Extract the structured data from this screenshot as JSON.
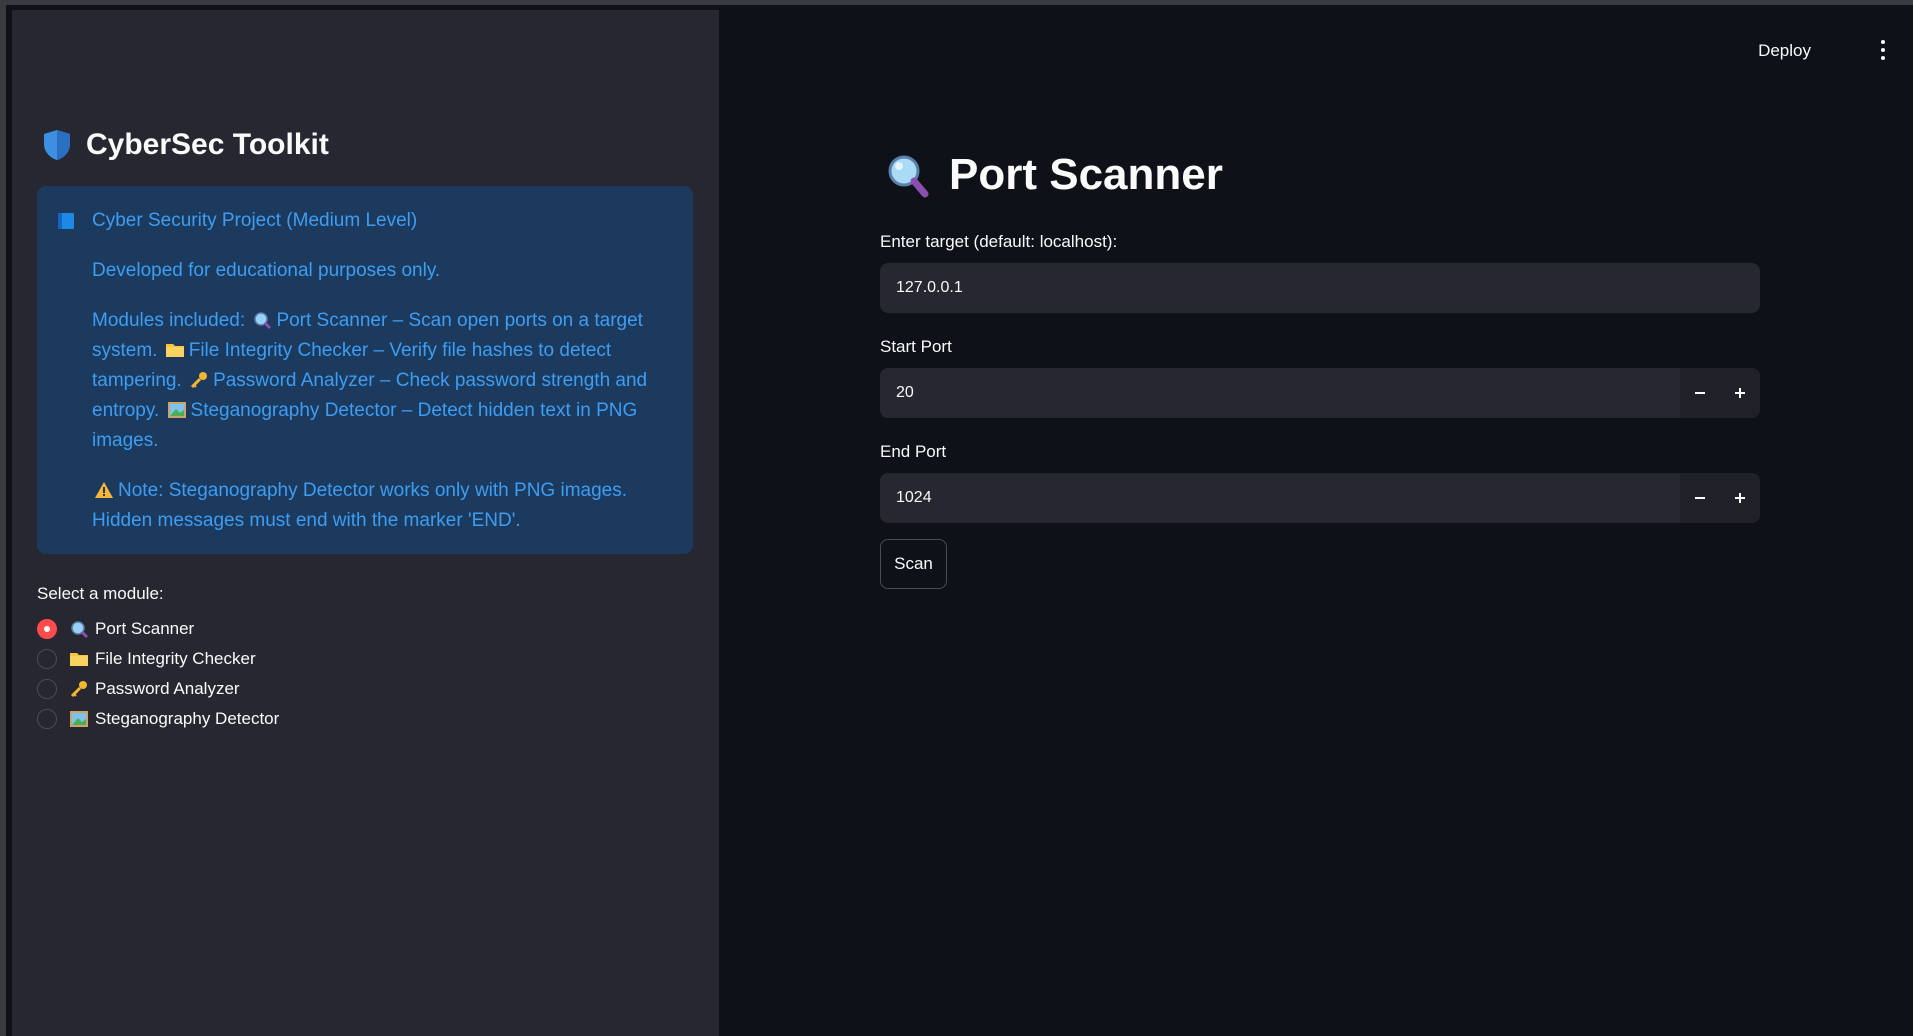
{
  "sidebar": {
    "title": "CyberSec Toolkit",
    "title_icon": "shield-icon",
    "info": {
      "book_icon": "blue-book-icon",
      "heading": "Cyber Security Project (Medium Level)",
      "purpose": "Developed for educational purposes only.",
      "modules_prefix": "Modules included:",
      "module_port": "Port Scanner – Scan open ports on a target system.",
      "module_file": "File Integrity Checker – Verify file hashes to detect tampering.",
      "module_password": "Password Analyzer – Check password strength and entropy.",
      "module_stego": "Steganography Detector – Detect hidden text in PNG images.",
      "note_line1": "Note: Steganography Detector works only with PNG images.",
      "note_line2": "Hidden messages must end with the marker 'END'."
    },
    "radio_label": "Select a module:",
    "radio_options": [
      {
        "label": "Port Scanner",
        "icon": "magnifier-icon",
        "checked": true
      },
      {
        "label": "File Integrity Checker",
        "icon": "folder-icon",
        "checked": false
      },
      {
        "label": "Password Analyzer",
        "icon": "key-icon",
        "checked": false
      },
      {
        "label": "Steganography Detector",
        "icon": "picture-icon",
        "checked": false
      }
    ]
  },
  "header": {
    "deploy_label": "Deploy",
    "menu_icon": "vertical-dots-icon"
  },
  "main": {
    "title": "Port Scanner",
    "title_icon": "magnifier-icon",
    "target_label": "Enter target (default: localhost):",
    "target_value": "127.0.0.1",
    "start_port_label": "Start Port",
    "start_port_value": "20",
    "end_port_label": "End Port",
    "end_port_value": "1024",
    "scan_label": "Scan"
  },
  "colors": {
    "accent": "#ff4b4b",
    "info_text": "#3d9df3",
    "info_bg": "#1c3a5e",
    "sidebar_bg": "#262730",
    "main_bg": "#0e1117"
  }
}
